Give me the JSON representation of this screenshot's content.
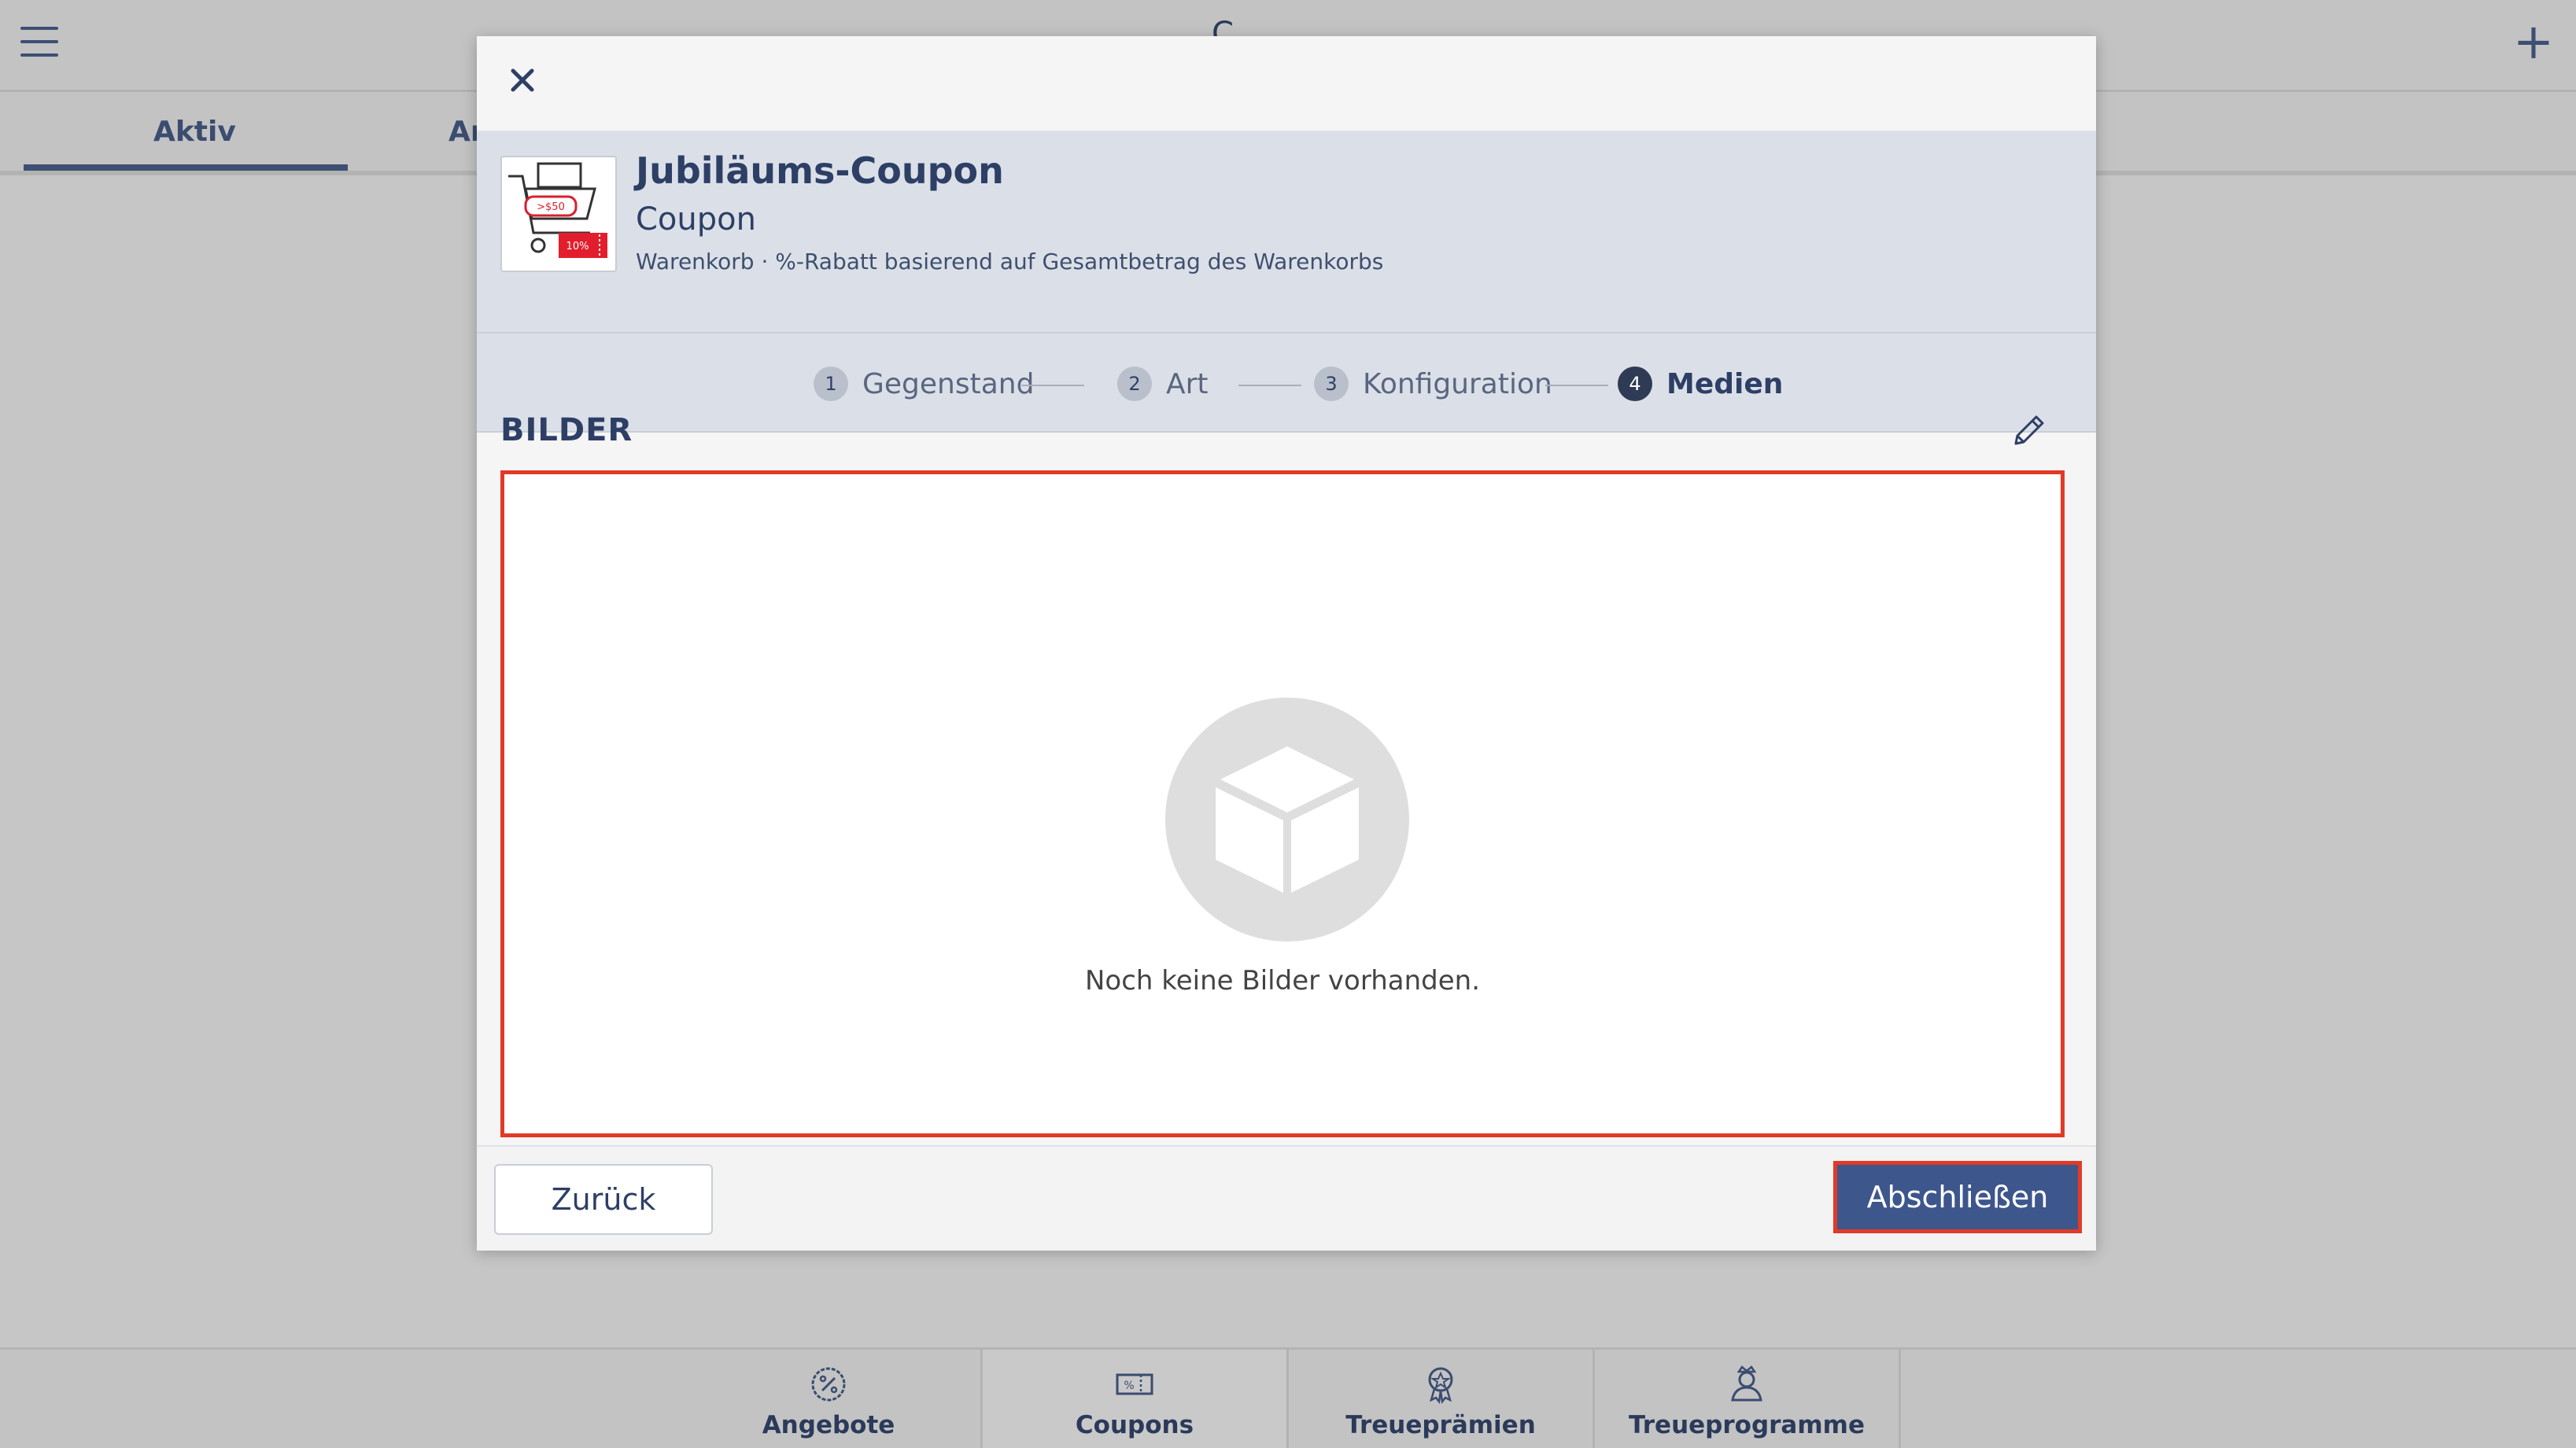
{
  "app": {
    "title": "C",
    "add_label": "+"
  },
  "tabs": [
    {
      "label": "Aktiv"
    },
    {
      "label": "Ar"
    }
  ],
  "bottom_nav": [
    {
      "label": "Angebote",
      "icon": "percent-badge-icon"
    },
    {
      "label": "Coupons",
      "icon": "coupon-icon"
    },
    {
      "label": "Treueprämien",
      "icon": "award-icon"
    },
    {
      "label": "Treueprogramme",
      "icon": "loyalty-user-icon"
    }
  ],
  "dialog": {
    "item": {
      "title": "Jubiläums-Coupon",
      "type": "Coupon",
      "description": "Warenkorb · %-Rabatt basierend auf Gesamtbetrag des Warenkorbs",
      "thumb_price_tag": ">$50",
      "thumb_discount_tag": "10%"
    },
    "steps": [
      {
        "num": "1",
        "label": "Gegenstand"
      },
      {
        "num": "2",
        "label": "Art"
      },
      {
        "num": "3",
        "label": "Konfiguration"
      },
      {
        "num": "4",
        "label": "Medien"
      }
    ],
    "active_step": 4,
    "section_title": "BILDER",
    "empty_text": "Noch keine Bilder vorhanden.",
    "back_label": "Zurück",
    "finish_label": "Abschließen"
  },
  "colors": {
    "accent": "#3d568c",
    "highlight_border": "#e13a26",
    "overlay_bg": "#c6c6c6"
  }
}
